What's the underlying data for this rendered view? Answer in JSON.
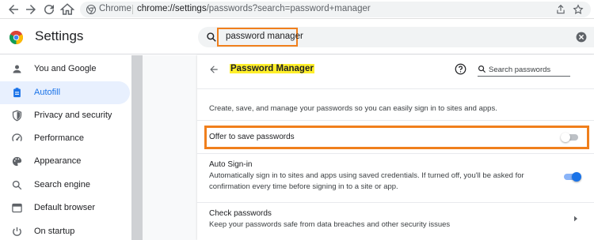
{
  "browser": {
    "site_label": "Chrome",
    "url_host": "chrome://settings",
    "url_rest": "/passwords?search=password+manager",
    "icons": [
      "back-arrow-icon",
      "forward-arrow-icon",
      "reload-icon",
      "home-icon",
      "share-icon",
      "bookmark-star-icon",
      "menu-icon"
    ]
  },
  "header": {
    "title": "Settings",
    "search_value": "password manager"
  },
  "sidebar": {
    "items": [
      {
        "label": "You and Google",
        "icon": "person-icon",
        "active": false
      },
      {
        "label": "Autofill",
        "icon": "clipboard-icon",
        "active": true
      },
      {
        "label": "Privacy and security",
        "icon": "shield-icon",
        "active": false
      },
      {
        "label": "Performance",
        "icon": "speedometer-icon",
        "active": false
      },
      {
        "label": "Appearance",
        "icon": "palette-icon",
        "active": false
      },
      {
        "label": "Search engine",
        "icon": "search-icon",
        "active": false
      },
      {
        "label": "Default browser",
        "icon": "browser-window-icon",
        "active": false
      },
      {
        "label": "On startup",
        "icon": "power-icon",
        "active": false
      }
    ]
  },
  "main": {
    "title": "Password Manager",
    "search_placeholder": "Search passwords",
    "description": "Create, save, and manage your passwords so you can easily sign in to sites and apps.",
    "offer_to_save": {
      "label": "Offer to save passwords",
      "enabled": false
    },
    "auto_signin": {
      "label": "Auto Sign-in",
      "description": "Automatically sign in to sites and apps using saved credentials. If turned off, you'll be asked for confirmation every time before signing in to a site or app.",
      "enabled": true
    },
    "check_passwords": {
      "label": "Check passwords",
      "description": "Keep your passwords safe from data breaches and other security issues"
    }
  },
  "colors": {
    "accent": "#1a73e8",
    "highlight_box": "#f07f1c",
    "title_highlight": "#ffef2a"
  }
}
